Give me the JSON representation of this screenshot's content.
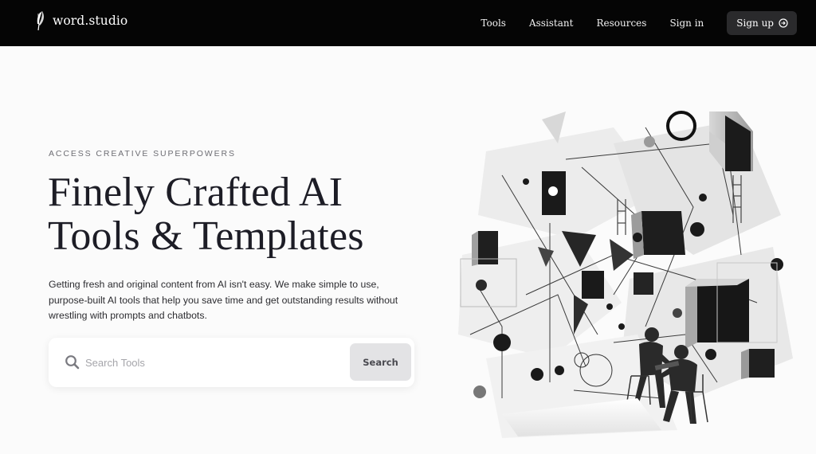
{
  "brand": {
    "name": "word.studio",
    "logo_icon": "quill-feather-icon"
  },
  "nav": {
    "links": [
      {
        "label": "Tools"
      },
      {
        "label": "Assistant"
      },
      {
        "label": "Resources"
      },
      {
        "label": "Sign in"
      }
    ],
    "signup": {
      "label": "Sign up",
      "icon": "arrow-circle-right-icon"
    }
  },
  "hero": {
    "eyebrow": "ACCESS CREATIVE SUPERPOWERS",
    "headline_line1": "Finely Crafted AI",
    "headline_line2": "Tools & Templates",
    "description": "Getting fresh and original content from AI isn't easy. We make  simple to use, purpose-built AI tools that help you save time and get outstanding results without wrestling with prompts and chatbots."
  },
  "search": {
    "placeholder": "Search Tools",
    "value": "",
    "button_label": "Search",
    "icon": "search-icon"
  },
  "illustration": {
    "subject": "abstract-geometric-collage-two-people-working"
  },
  "colors": {
    "navbar_bg": "#050505",
    "page_bg": "#fbfbfb",
    "signup_bg": "#2a2a2c",
    "search_button_bg": "#e3e3e5"
  }
}
